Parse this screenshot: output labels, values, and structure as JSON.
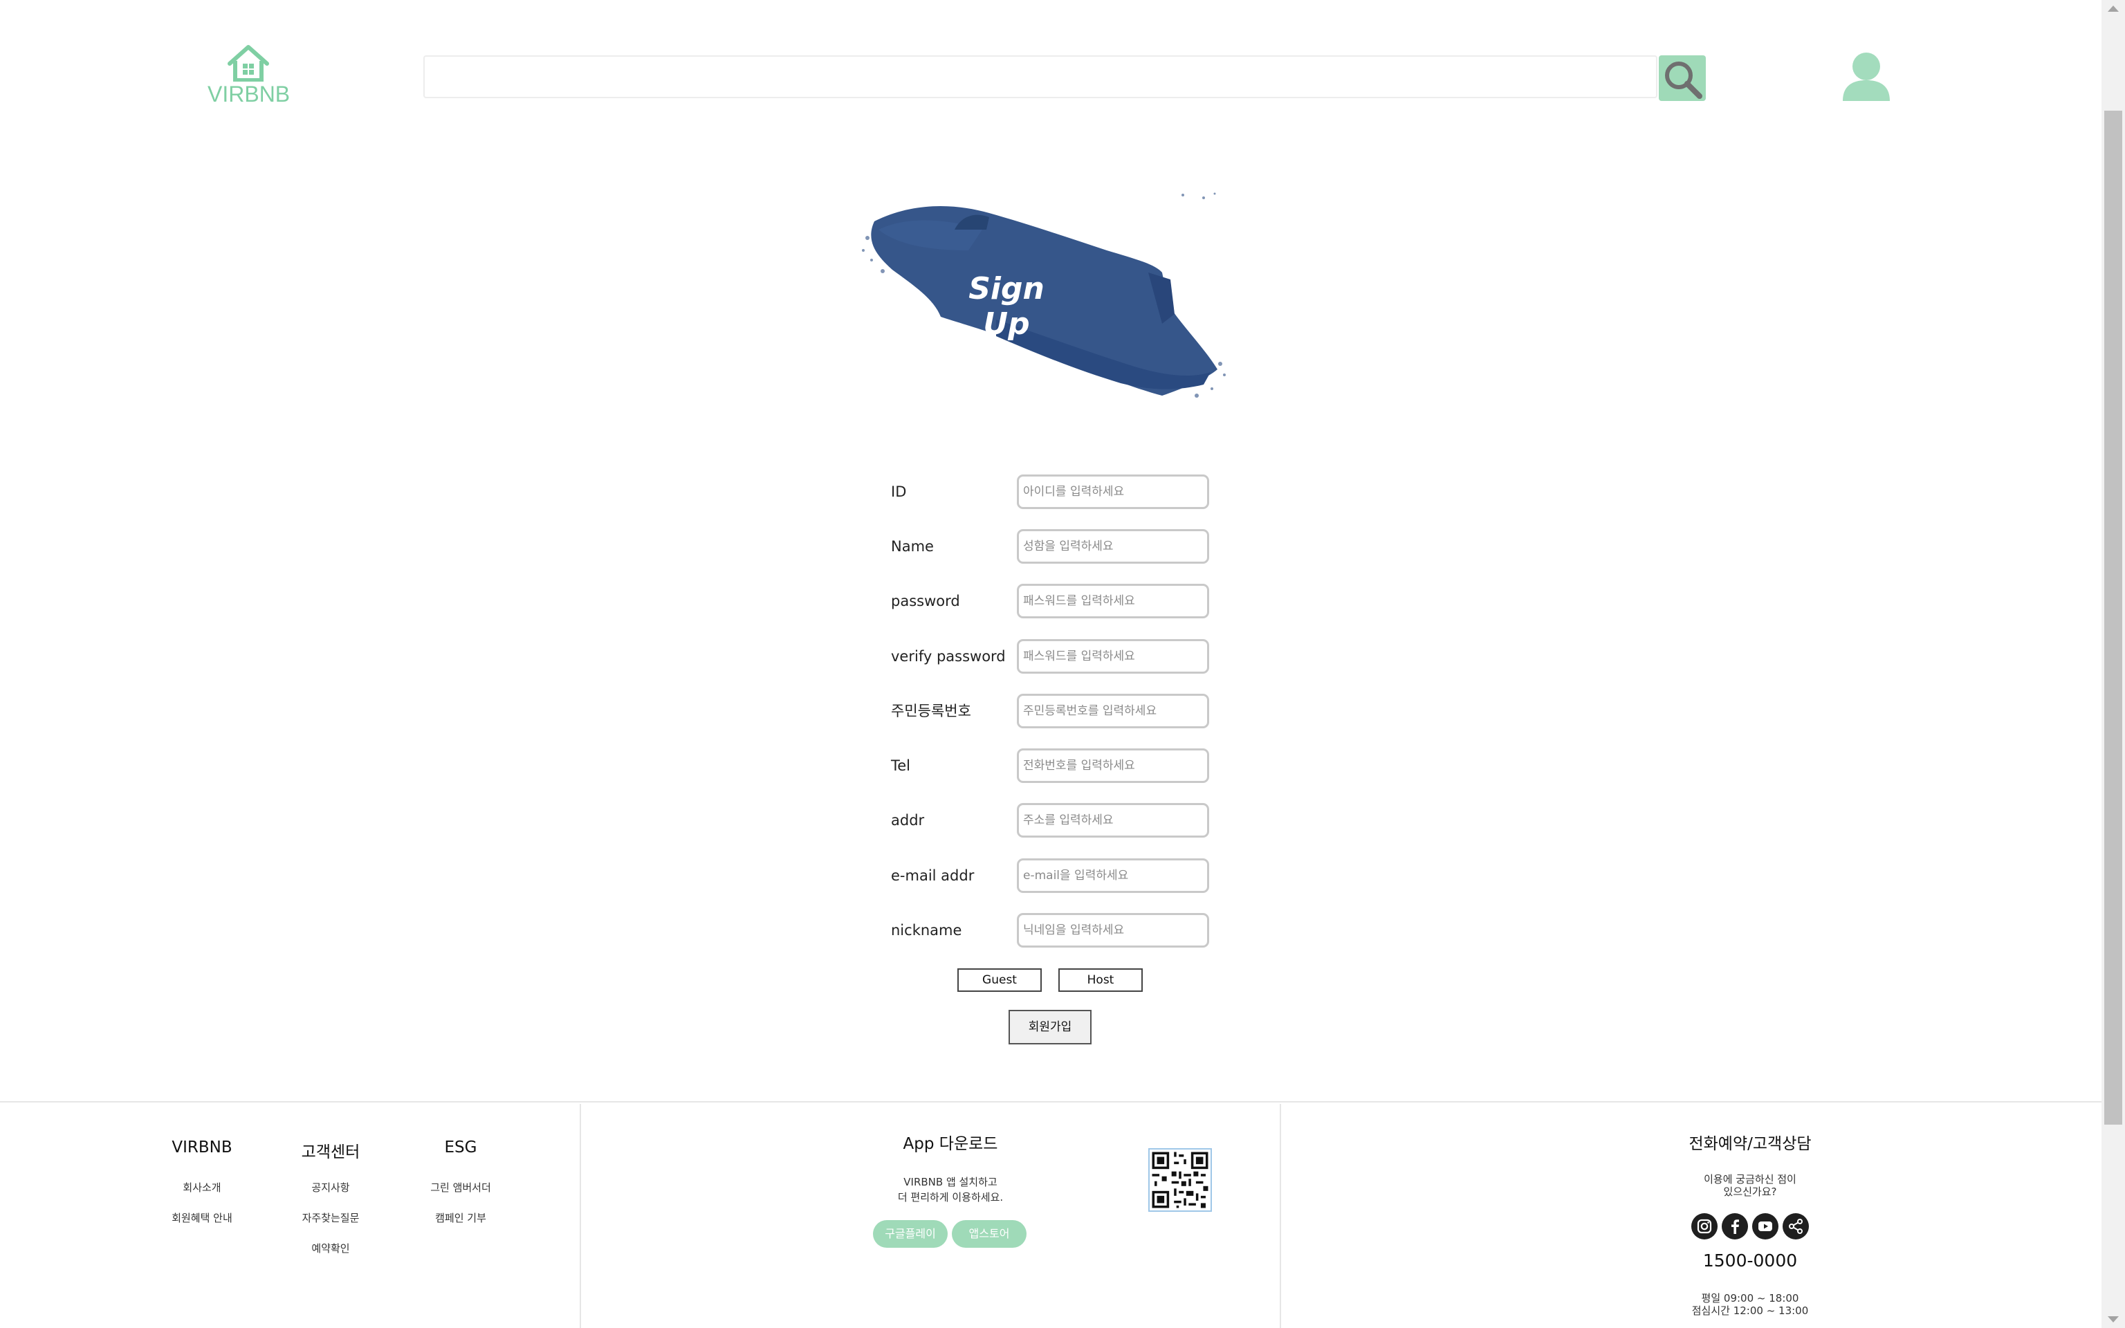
{
  "brand": {
    "logo_text": "VIRBNB",
    "accent_color": "#7fcfa3",
    "button_color": "#9fdab8"
  },
  "header": {
    "search_placeholder": "",
    "search_icon": "search-icon",
    "user_icon": "user-icon"
  },
  "title": {
    "text": "Sign Up",
    "brush_color": "#2e4f85"
  },
  "form": {
    "fields": [
      {
        "label": "ID",
        "placeholder": "아이디를 입력하세요"
      },
      {
        "label": "Name",
        "placeholder": "성함을 입력하세요"
      },
      {
        "label": "password",
        "placeholder": "패스워드를 입력하세요"
      },
      {
        "label": "verify password",
        "placeholder": "패스워드를 입력하세요"
      },
      {
        "label": "주민등록번호",
        "placeholder": "주민등록번호를 입력하세요"
      },
      {
        "label": "Tel",
        "placeholder": "전화번호를 입력하세요"
      },
      {
        "label": "addr",
        "placeholder": "주소를 입력하세요"
      },
      {
        "label": "e-mail addr",
        "placeholder": "e-mail을 입력하세요"
      },
      {
        "label": "nickname",
        "placeholder": "닉네임을 입력하세요"
      }
    ],
    "user_types": [
      "Guest",
      "Host"
    ],
    "submit_label": "회원가입"
  },
  "footer": {
    "columns": [
      {
        "title": "VIRBNB",
        "links": [
          "회사소개",
          "회원혜택 안내"
        ]
      },
      {
        "title": "고객센터",
        "links": [
          "공지사항",
          "자주찾는질문",
          "예약확인"
        ]
      },
      {
        "title": "ESG",
        "links": [
          "그린 앰버서더",
          "캠페인 기부"
        ]
      }
    ],
    "app": {
      "title": "App 다운로드",
      "desc_line1": "VIRBNB 앱 설치하고",
      "desc_line2": "더 편리하게 이용하세요.",
      "google_play": "구글플레이",
      "app_store": "앱스토어",
      "qr_icon": "qr-code"
    },
    "contact": {
      "title": "전화예약/고객상담",
      "desc_line1": "이용에 궁금하신 점이",
      "desc_line2": "있으신가요?",
      "social_icons": [
        "instagram-icon",
        "facebook-icon",
        "youtube-icon",
        "share-icon"
      ],
      "phone": "1500-0000",
      "hours_line1": "평일 09:00 ~ 18:00",
      "hours_line2": "점심시간 12:00 ~ 13:00"
    }
  }
}
